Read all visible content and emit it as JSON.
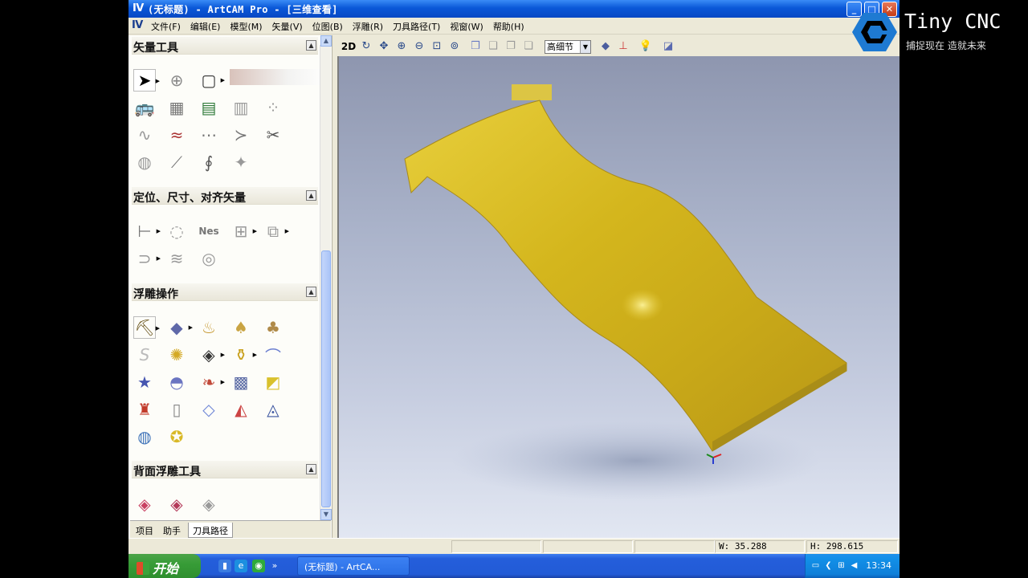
{
  "window": {
    "title": "(无标题) - ArtCAM Pro - [三维查看]",
    "controls": {
      "minimize": "_",
      "maximize": "□",
      "close": "✕"
    }
  },
  "menu": {
    "items": [
      "文件(F)",
      "编辑(E)",
      "模型(M)",
      "矢量(V)",
      "位图(B)",
      "浮雕(R)",
      "刀具路径(T)",
      "视窗(W)",
      "帮助(H)"
    ]
  },
  "left_panel": {
    "sections": [
      {
        "title": "矢量工具"
      },
      {
        "title": "定位、尺寸、对齐矢量"
      },
      {
        "title": "浮雕操作"
      },
      {
        "title": "背面浮雕工具"
      }
    ],
    "tabs": [
      "项目",
      "助手",
      "刀具路径"
    ],
    "active_tab": "刀具路径"
  },
  "view_toolbar": {
    "mode_2d": "2D",
    "quality": "高细节"
  },
  "status_bar": {
    "width_readout": "W: 35.288",
    "height_readout": "H: 298.615"
  },
  "taskbar": {
    "start": "开始",
    "task_title": "(无标题) - ArtCA...",
    "clock": "13:34"
  },
  "brand": {
    "name": "Tiny CNC",
    "slogan": "捕捉现在  造就未来"
  },
  "colors": {
    "title_blue": "#0a58d8",
    "model_gold": "#d4b61d",
    "viewport_top": "#8e96af",
    "viewport_bottom": "#e2e7f2",
    "taskbar_blue": "#245edb",
    "start_green": "#379c37"
  }
}
